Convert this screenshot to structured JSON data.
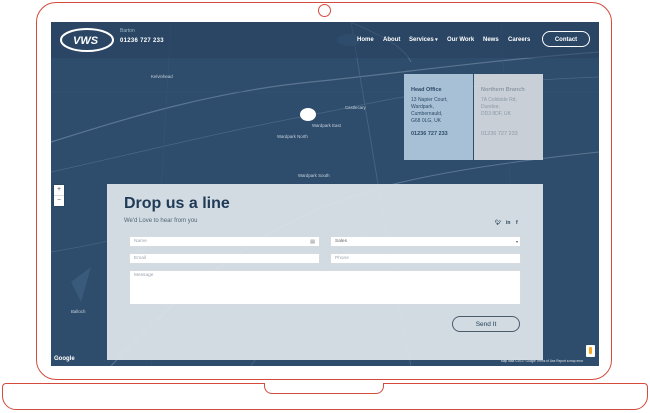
{
  "header": {
    "branch": "Barton",
    "phone": "01236 727 233",
    "logo_text": "VWS",
    "nav": [
      "Home",
      "About",
      "Services",
      "Our Work",
      "News",
      "Careers"
    ],
    "contact_label": "Contact"
  },
  "map": {
    "labels": [
      "Kelvinhead",
      "Castlecary",
      "Wardpark East",
      "Wardpark North",
      "Wardpark South",
      "Balloch",
      "Cumbernauld",
      "Condorrat",
      "Carrickstone"
    ],
    "google_label": "Google",
    "terms": "Map data ©2017 Google   Terms of Use   Report a map error",
    "zoom_in": "+",
    "zoom_out": "−"
  },
  "offices": {
    "head": {
      "title": "Head Office",
      "lines": [
        "13 Napier Court,",
        "Wardpark,",
        "Cumbernauld,",
        "G68 0LG, UK"
      ],
      "phone": "01236 727 233"
    },
    "north": {
      "title": "Northern Branch",
      "lines": [
        "7A Coldside Rd,",
        "Dundee,",
        "DD3 8DF, UK"
      ],
      "phone": "01236 727 233"
    }
  },
  "form": {
    "title": "Drop us a line",
    "subtitle": "We'd Love to hear from you",
    "social": [
      "twitter-icon",
      "linkedin-icon",
      "facebook-icon"
    ],
    "name_placeholder": "Name",
    "sales_value": "Sales",
    "email_placeholder": "Email",
    "phone_placeholder": "Phone",
    "message_placeholder": "Message",
    "send_label": "Send It"
  },
  "colors": {
    "frame": "#d44a3c",
    "map_bg": "#2e4c6b",
    "head_card": "#a8c0d6",
    "north_card": "#c8cfd6",
    "title": "#1f3a56"
  }
}
